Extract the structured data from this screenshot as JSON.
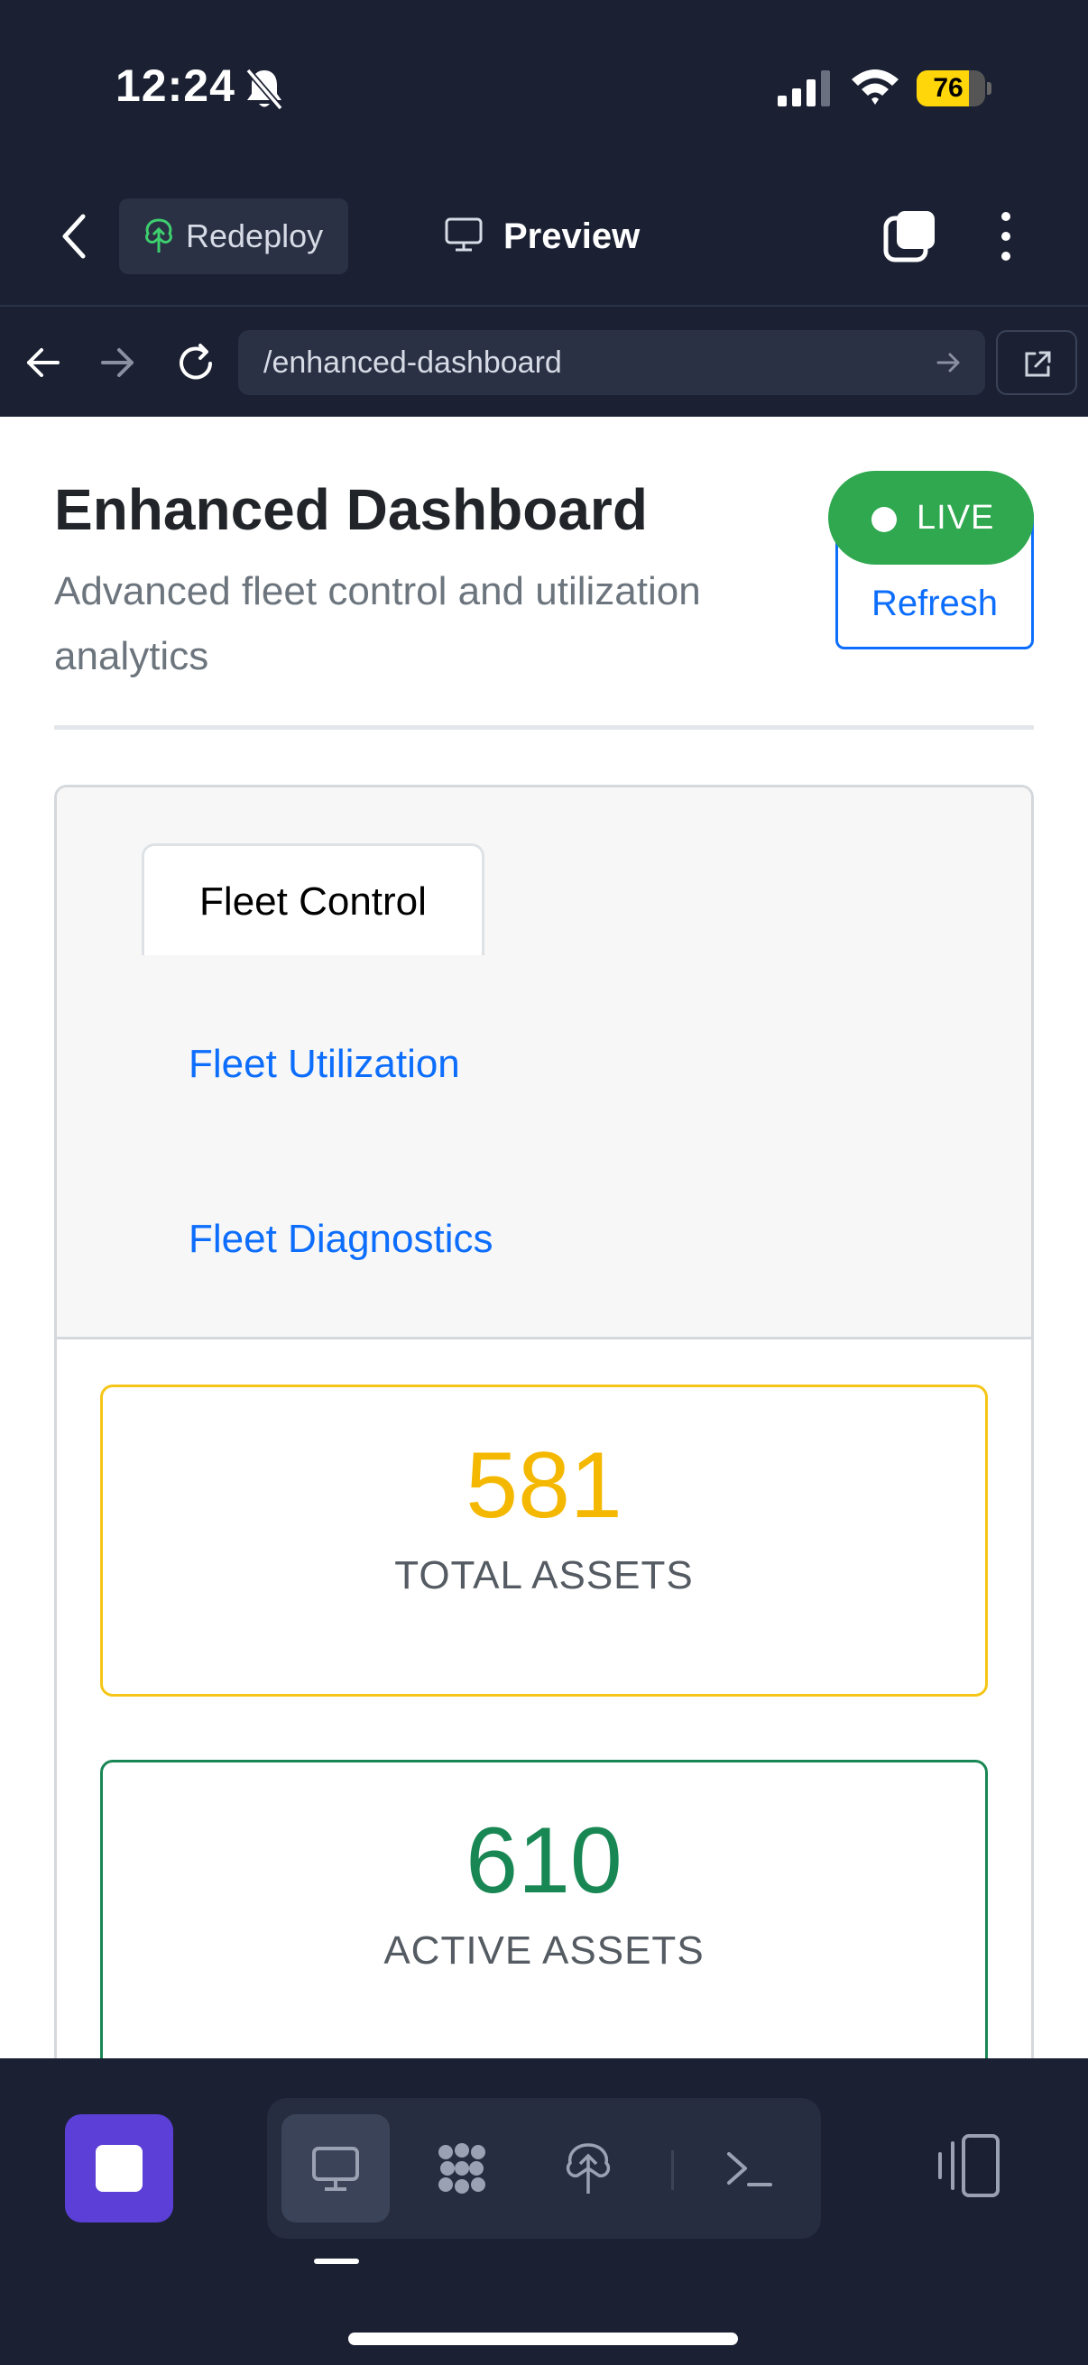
{
  "status_bar": {
    "time": "12:24",
    "battery": "76",
    "battery_level": 0.76
  },
  "app_bar": {
    "redeploy_label": "Redeploy",
    "preview_label": "Preview"
  },
  "url_bar": {
    "url": "/enhanced-dashboard"
  },
  "page": {
    "title": "Enhanced Dashboard",
    "subtitle": "Advanced fleet control and utilization analytics",
    "refresh_label": "Refresh",
    "live_label": "LIVE"
  },
  "tabs": [
    {
      "label": "Fleet Control",
      "active": true
    },
    {
      "label": "Fleet Utilization",
      "active": false
    },
    {
      "label": "Fleet Diagnostics",
      "active": false
    }
  ],
  "stats": [
    {
      "value": "581",
      "label": "TOTAL ASSETS",
      "color": "#f5b800"
    },
    {
      "value": "610",
      "label": "ACTIVE ASSETS",
      "color": "#198754"
    }
  ],
  "colors": {
    "background_dark": "#1b2133",
    "link_blue": "#0d6efd",
    "live_green": "#2fa84f",
    "stop_purple": "#5b3fd6"
  },
  "icons": {
    "bottom_tools": [
      "monitor-icon",
      "cluster-icon",
      "deploy-icon",
      "terminal-icon"
    ]
  }
}
